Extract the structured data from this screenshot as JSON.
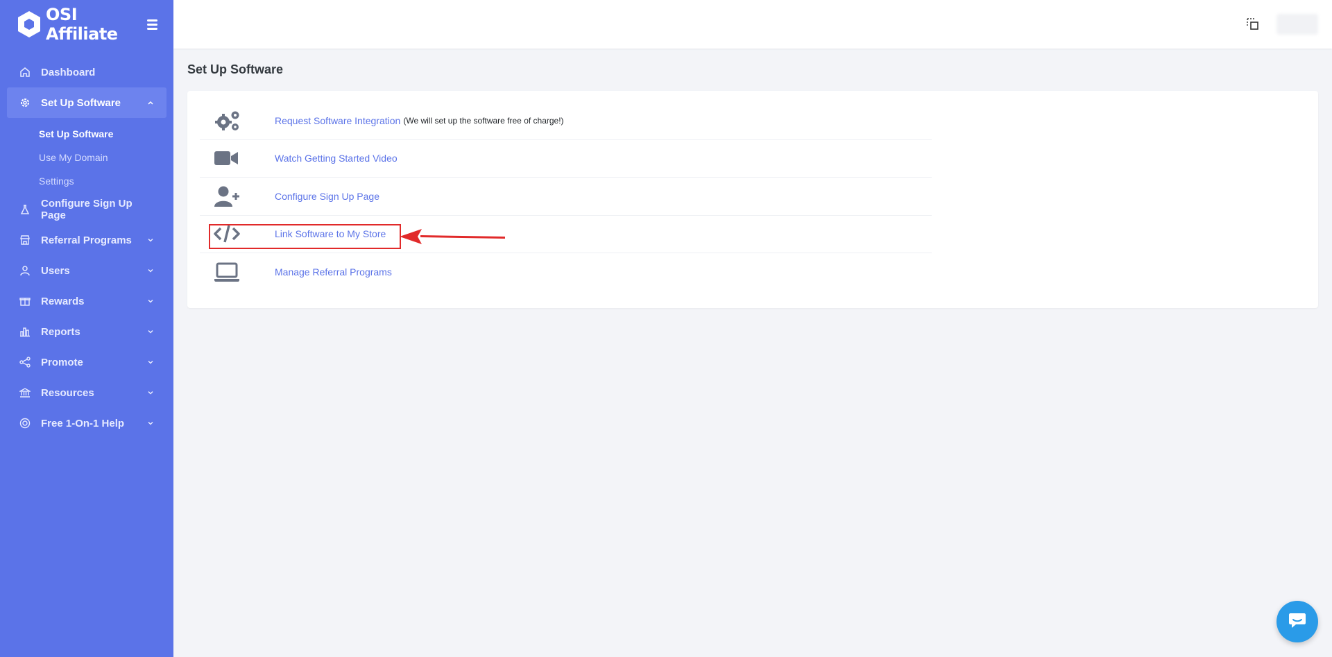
{
  "brand": {
    "name": "OSI Affiliate"
  },
  "sidebar": {
    "items": [
      {
        "label": "Dashboard",
        "icon": "home-icon"
      },
      {
        "label": "Set Up Software",
        "icon": "gear-icon",
        "expanded": true,
        "sub": [
          "Set Up Software",
          "Use My Domain",
          "Settings"
        ]
      },
      {
        "label": "Configure Sign Up Page",
        "icon": "flask-icon"
      },
      {
        "label": "Referral Programs",
        "icon": "store-icon"
      },
      {
        "label": "Users",
        "icon": "user-icon"
      },
      {
        "label": "Rewards",
        "icon": "gift-icon"
      },
      {
        "label": "Reports",
        "icon": "bar-chart-icon"
      },
      {
        "label": "Promote",
        "icon": "share-icon"
      },
      {
        "label": "Resources",
        "icon": "bank-icon"
      },
      {
        "label": "Free 1-On-1 Help",
        "icon": "lifebuoy-icon"
      }
    ]
  },
  "main": {
    "title": "Set Up Software",
    "rows": [
      {
        "label": "Request Software Integration",
        "note": "(We will set up the software free of charge!)",
        "icon": "cogs-icon"
      },
      {
        "label": "Watch Getting Started Video",
        "icon": "video-camera-icon"
      },
      {
        "label": "Configure Sign Up Page",
        "icon": "user-plus-icon"
      },
      {
        "label": "Link Software to My Store",
        "icon": "code-icon"
      },
      {
        "label": "Manage Referral Programs",
        "icon": "laptop-icon"
      }
    ]
  },
  "colors": {
    "sidebar": "#5b73e8",
    "link": "#5b73e8",
    "highlight": "#e12a2a",
    "chat": "#2a9be8"
  }
}
